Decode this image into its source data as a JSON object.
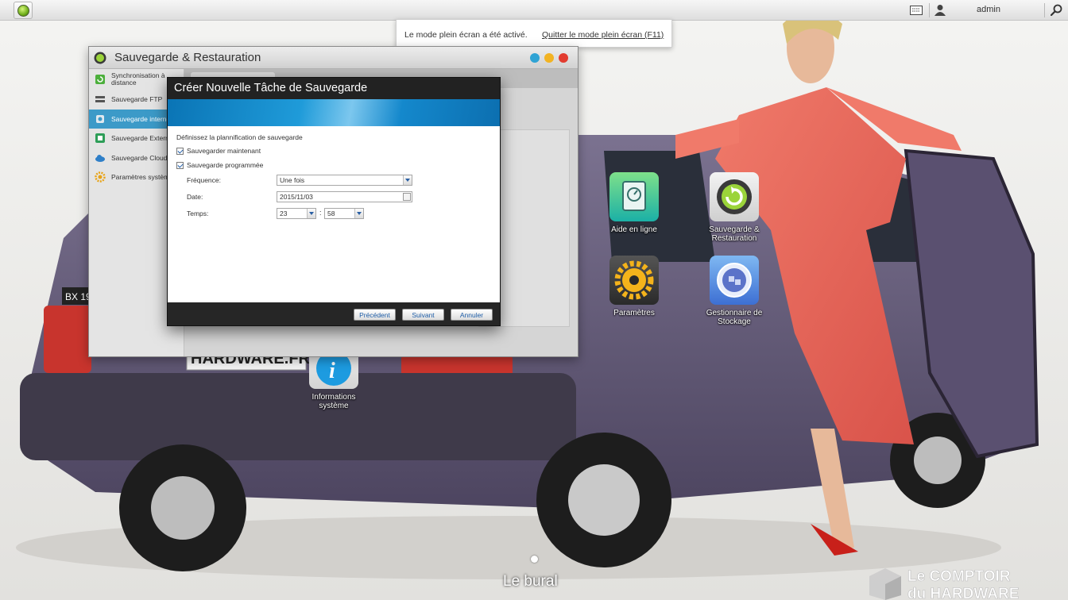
{
  "topbar": {
    "user": "admin"
  },
  "notification": {
    "message": "Le mode plein écran a été activé.",
    "link": "Quitter le mode plein écran (F11)"
  },
  "desktop": {
    "icons": [
      {
        "label": [
          "Aide en ligne"
        ]
      },
      {
        "label": [
          "Sauvegarde &",
          "Restauration"
        ]
      },
      {
        "label": [
          "Paramètres"
        ]
      },
      {
        "label": [
          "Gestionnaire de",
          "Stockage"
        ]
      },
      {
        "label": [
          "Informations",
          "système"
        ]
      }
    ],
    "name": "Le bural",
    "watermark_top": "Le COMPTOIR",
    "watermark_bottom": "du HARDWARE"
  },
  "app_window": {
    "title": "Sauvegarde & Restauration",
    "sidebar": [
      {
        "label": "Synchronisation à distance"
      },
      {
        "label": "Sauvegarde FTP"
      },
      {
        "label": "Sauvegarde interne"
      },
      {
        "label": "Sauvegarde Externe"
      },
      {
        "label": "Sauvegarde Cloud"
      },
      {
        "label": "Paramètres système"
      }
    ]
  },
  "dialog": {
    "title": "Créer Nouvelle Tâche de Sauvegarde",
    "section": "Définissez la plannification de sauvegarde",
    "backup_now": "Sauvegarder maintenant",
    "scheduled": "Sauvegarde programmée",
    "frequency_label": "Fréquence:",
    "frequency_value": "Une fois",
    "date_label": "Date:",
    "date_value": "2015/11/03",
    "time_label": "Temps:",
    "hour_value": "23",
    "minute_value": "58",
    "time_separator": ":",
    "buttons": {
      "previous": "Précédent",
      "next": "Suivant",
      "cancel": "Annuler"
    }
  },
  "wallpaper_plate": "BX 19",
  "wallpaper_plate2": "HARDWARE.FR"
}
